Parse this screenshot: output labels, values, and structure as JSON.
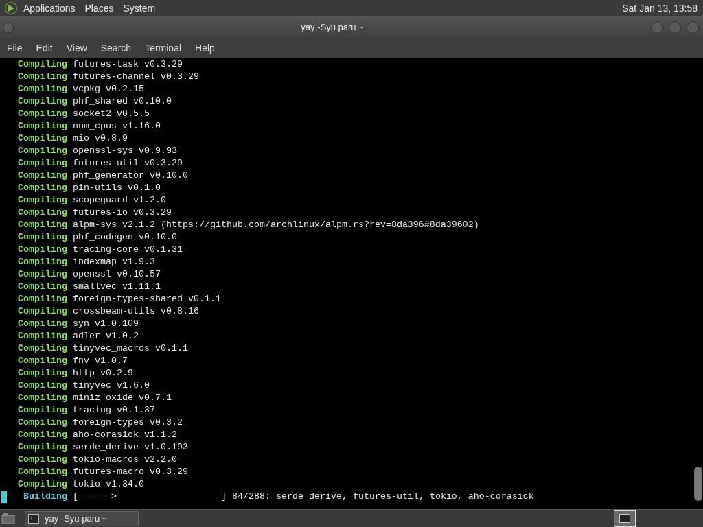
{
  "top_panel": {
    "menus": [
      "Applications",
      "Places",
      "System"
    ],
    "clock": "Sat Jan 13, 13:58"
  },
  "window": {
    "title": "yay -Syu paru ~"
  },
  "menu_bar": [
    "File",
    "Edit",
    "View",
    "Search",
    "Terminal",
    "Help"
  ],
  "terminal": {
    "lines": [
      {
        "kind": "compiling",
        "verb": "Compiling",
        "text": "futures-task v0.3.29"
      },
      {
        "kind": "compiling",
        "verb": "Compiling",
        "text": "futures-channel v0.3.29"
      },
      {
        "kind": "compiling",
        "verb": "Compiling",
        "text": "vcpkg v0.2.15"
      },
      {
        "kind": "compiling",
        "verb": "Compiling",
        "text": "phf_shared v0.10.0"
      },
      {
        "kind": "compiling",
        "verb": "Compiling",
        "text": "socket2 v0.5.5"
      },
      {
        "kind": "compiling",
        "verb": "Compiling",
        "text": "num_cpus v1.16.0"
      },
      {
        "kind": "compiling",
        "verb": "Compiling",
        "text": "mio v0.8.9"
      },
      {
        "kind": "compiling",
        "verb": "Compiling",
        "text": "openssl-sys v0.9.93"
      },
      {
        "kind": "compiling",
        "verb": "Compiling",
        "text": "futures-util v0.3.29"
      },
      {
        "kind": "compiling",
        "verb": "Compiling",
        "text": "phf_generator v0.10.0"
      },
      {
        "kind": "compiling",
        "verb": "Compiling",
        "text": "pin-utils v0.1.0"
      },
      {
        "kind": "compiling",
        "verb": "Compiling",
        "text": "scopeguard v1.2.0"
      },
      {
        "kind": "compiling",
        "verb": "Compiling",
        "text": "futures-io v0.3.29"
      },
      {
        "kind": "compiling",
        "verb": "Compiling",
        "text": "alpm-sys v2.1.2 (https://github.com/archlinux/alpm.rs?rev=8da396#8da39602)"
      },
      {
        "kind": "compiling",
        "verb": "Compiling",
        "text": "phf_codegen v0.10.0"
      },
      {
        "kind": "compiling",
        "verb": "Compiling",
        "text": "tracing-core v0.1.31"
      },
      {
        "kind": "compiling",
        "verb": "Compiling",
        "text": "indexmap v1.9.3"
      },
      {
        "kind": "compiling",
        "verb": "Compiling",
        "text": "openssl v0.10.57"
      },
      {
        "kind": "compiling",
        "verb": "Compiling",
        "text": "smallvec v1.11.1"
      },
      {
        "kind": "compiling",
        "verb": "Compiling",
        "text": "foreign-types-shared v0.1.1"
      },
      {
        "kind": "compiling",
        "verb": "Compiling",
        "text": "crossbeam-utils v0.8.16"
      },
      {
        "kind": "compiling",
        "verb": "Compiling",
        "text": "syn v1.0.109"
      },
      {
        "kind": "compiling",
        "verb": "Compiling",
        "text": "adler v1.0.2"
      },
      {
        "kind": "compiling",
        "verb": "Compiling",
        "text": "tinyvec_macros v0.1.1"
      },
      {
        "kind": "compiling",
        "verb": "Compiling",
        "text": "fnv v1.0.7"
      },
      {
        "kind": "compiling",
        "verb": "Compiling",
        "text": "http v0.2.9"
      },
      {
        "kind": "compiling",
        "verb": "Compiling",
        "text": "tinyvec v1.6.0"
      },
      {
        "kind": "compiling",
        "verb": "Compiling",
        "text": "miniz_oxide v0.7.1"
      },
      {
        "kind": "compiling",
        "verb": "Compiling",
        "text": "tracing v0.1.37"
      },
      {
        "kind": "compiling",
        "verb": "Compiling",
        "text": "foreign-types v0.3.2"
      },
      {
        "kind": "compiling",
        "verb": "Compiling",
        "text": "aho-corasick v1.1.2"
      },
      {
        "kind": "compiling",
        "verb": "Compiling",
        "text": "serde_derive v1.0.193"
      },
      {
        "kind": "compiling",
        "verb": "Compiling",
        "text": "tokio-macros v2.2.0"
      },
      {
        "kind": "compiling",
        "verb": "Compiling",
        "text": "futures-macro v0.3.29"
      },
      {
        "kind": "compiling",
        "verb": "Compiling",
        "text": "tokio v1.34.0"
      },
      {
        "kind": "building",
        "verb": "Building",
        "text": "[======>                   ] 84/288: serde_derive, futures-util, tokio, aho-corasick"
      }
    ]
  },
  "taskbar": {
    "tasks": [
      {
        "label": "yay -Syu paru ~",
        "selected": false
      }
    ],
    "workspaces": [
      {
        "selected": true
      },
      {
        "selected": false
      },
      {
        "selected": false
      },
      {
        "selected": false
      }
    ]
  }
}
